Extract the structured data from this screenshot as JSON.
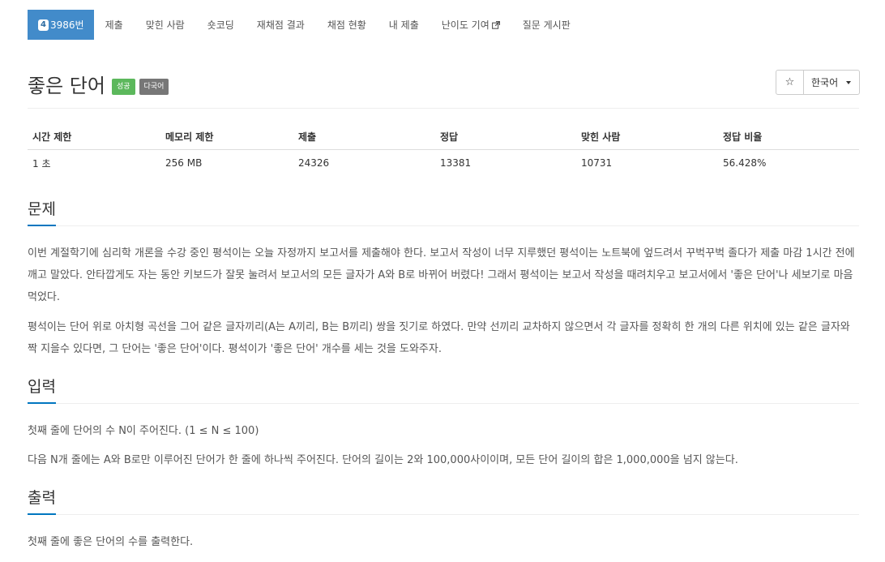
{
  "nav": {
    "problem_number": "3986번",
    "problem_badge": "4",
    "items": [
      "제출",
      "맞힌 사람",
      "숏코딩",
      "재채점 결과",
      "채점 현황",
      "내 제출",
      "난이도 기여",
      "질문 게시판"
    ]
  },
  "problem": {
    "title": "좋은 단어",
    "label_success": "성공",
    "label_lang": "다국어"
  },
  "controls": {
    "star_icon": "☆",
    "language": "한국어"
  },
  "info_table": {
    "headers": [
      "시간 제한",
      "메모리 제한",
      "제출",
      "정답",
      "맞힌 사람",
      "정답 비율"
    ],
    "values": [
      "1 초",
      "256 MB",
      "24326",
      "13381",
      "10731",
      "56.428%"
    ]
  },
  "sections": {
    "problem": {
      "title": "문제",
      "paragraphs": [
        "이번 계절학기에 심리학 개론을 수강 중인 평석이는 오늘 자정까지 보고서를 제출해야 한다. 보고서 작성이 너무 지루했던 평석이는 노트북에 엎드려서 꾸벅꾸벅 졸다가 제출 마감 1시간 전에 깨고 말았다. 안타깝게도 자는 동안 키보드가 잘못 눌려서 보고서의 모든 글자가 A와 B로 바뀌어 버렸다! 그래서 평석이는 보고서 작성을 때려치우고 보고서에서 '좋은 단어'나 세보기로 마음 먹었다.",
        "평석이는 단어 위로 아치형 곡선을 그어 같은 글자끼리(A는 A끼리, B는 B끼리) 쌍을 짓기로 하였다. 만약 선끼리 교차하지 않으면서 각 글자를 정확히 한 개의 다른 위치에 있는 같은 글자와 짝 지을수 있다면, 그 단어는 '좋은 단어'이다. 평석이가 '좋은 단어' 개수를 세는 것을 도와주자."
      ]
    },
    "input": {
      "title": "입력",
      "paragraphs": [
        "첫째 줄에 단어의 수 N이 주어진다. (1 ≤ N ≤ 100)",
        "다음 N개 줄에는 A와 B로만 이루어진 단어가 한 줄에 하나씩 주어진다. 단어의 길이는 2와 100,000사이이며, 모든 단어 길이의 합은 1,000,000을 넘지 않는다."
      ]
    },
    "output": {
      "title": "출력",
      "paragraphs": [
        "첫째 줄에 좋은 단어의 수를 출력한다."
      ]
    }
  },
  "colors": {
    "nav_active": "#428bca",
    "success": "#5cb85c",
    "lang_label": "#777777",
    "section_underline": "#0076c0"
  }
}
